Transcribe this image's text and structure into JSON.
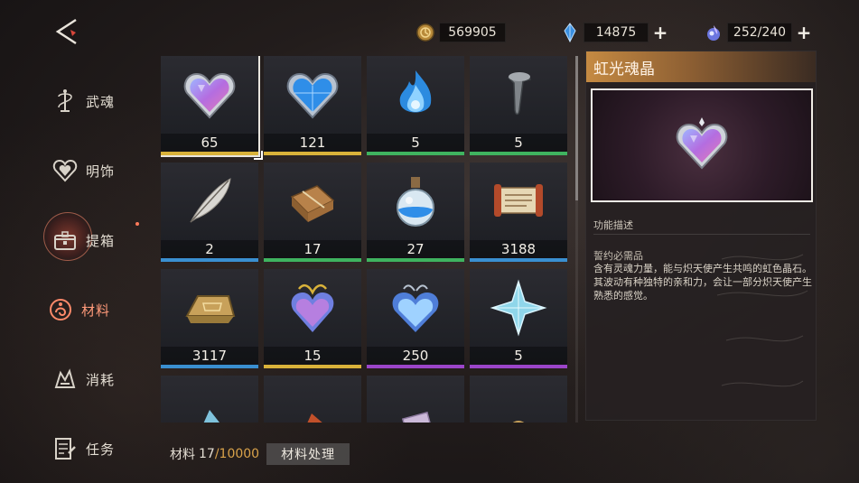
{
  "currencies": [
    {
      "icon": "gold-coin-icon",
      "value": "569905",
      "has_plus": false
    },
    {
      "icon": "blue-crystal-icon",
      "value": "14875",
      "has_plus": true
    },
    {
      "icon": "soul-flame-icon",
      "value": "252/240",
      "has_plus": true
    }
  ],
  "sidebar": {
    "items": [
      {
        "label": "武魂",
        "icon": "weapon-soul-icon",
        "active": false
      },
      {
        "label": "明饰",
        "icon": "ornament-heart-icon",
        "active": false
      },
      {
        "label": "提箱",
        "icon": "chest-icon",
        "active": false
      },
      {
        "label": "材料",
        "icon": "materials-icon",
        "active": true
      },
      {
        "label": "消耗",
        "icon": "consumable-icon",
        "active": false
      },
      {
        "label": "任务",
        "icon": "quest-icon",
        "active": false
      }
    ]
  },
  "inventory": {
    "items": [
      {
        "count": "65",
        "icon": "rainbow-soul-heart-icon",
        "rarity_color": "#d9b23a",
        "selected": true
      },
      {
        "count": "121",
        "icon": "blue-heart-gem-icon",
        "rarity_color": "#d9b23a"
      },
      {
        "count": "5",
        "icon": "blue-flame-icon",
        "rarity_color": "#3fb35f"
      },
      {
        "count": "5",
        "icon": "iron-nail-icon",
        "rarity_color": "#3fb35f"
      },
      {
        "count": "2",
        "icon": "feather-icon",
        "rarity_color": "#3a8fd0"
      },
      {
        "count": "17",
        "icon": "bundle-icon",
        "rarity_color": "#3fb35f"
      },
      {
        "count": "27",
        "icon": "potion-flask-icon",
        "rarity_color": "#3fb35f"
      },
      {
        "count": "3188",
        "icon": "scroll-icon",
        "rarity_color": "#3a8fd0"
      },
      {
        "count": "3117",
        "icon": "gold-ingot-icon",
        "rarity_color": "#3a8fd0"
      },
      {
        "count": "15",
        "icon": "gilded-heart-icon",
        "rarity_color": "#d9b23a"
      },
      {
        "count": "250",
        "icon": "crystal-heart-icon",
        "rarity_color": "#9b45c9"
      },
      {
        "count": "5",
        "icon": "ice-star-icon",
        "rarity_color": "#9b45c9"
      },
      {
        "count": "",
        "icon": "ice-shard-icon",
        "rarity_color": ""
      },
      {
        "count": "",
        "icon": "ember-shard-icon",
        "rarity_color": ""
      },
      {
        "count": "",
        "icon": "card-icon",
        "rarity_color": ""
      },
      {
        "count": "",
        "icon": "coin-icon",
        "rarity_color": ""
      }
    ]
  },
  "detail": {
    "title": "虹光魂晶",
    "section_title": "功能描述",
    "subtitle": "誓约必需品",
    "description": "含有灵魂力量，能与炽天使产生共鸣的虹色晶石。其波动有种独特的亲和力，会让一部分炽天使产生熟悉的感觉。"
  },
  "footer": {
    "label": "材料",
    "count": "17",
    "capacity": "/10000",
    "process_button": "材料处理"
  },
  "colors": {
    "header_gold": "#c58a42",
    "active_tab": "#ff9a7a",
    "capacity_text": "#d9a24a"
  }
}
